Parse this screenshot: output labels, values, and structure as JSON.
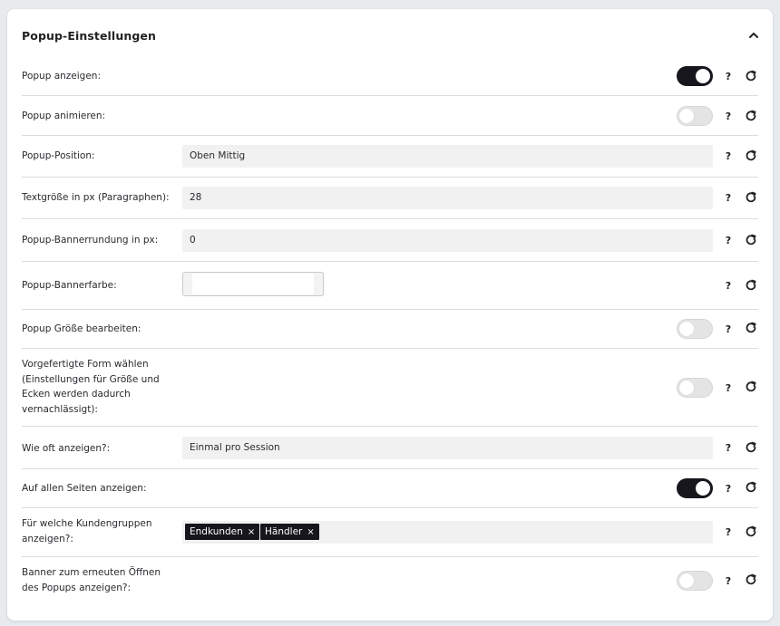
{
  "header": {
    "title": "Popup-Einstellungen",
    "collapse_icon": "chevron-up-icon"
  },
  "rows": [
    {
      "label": "Popup anzeigen:",
      "type": "toggle",
      "on": true
    },
    {
      "label": "Popup animieren:",
      "type": "toggle",
      "on": false
    },
    {
      "label": "Popup-Position:",
      "type": "select",
      "value": "Oben Mittig"
    },
    {
      "label": "Textgröße in px (Paragraphen):",
      "type": "input",
      "value": "28"
    },
    {
      "label": "Popup-Bannerrundung in px:",
      "type": "input",
      "value": "0"
    },
    {
      "label": "Popup-Bannerfarbe:",
      "type": "color",
      "value": "#ffffff"
    },
    {
      "label": "Popup Größe bearbeiten:",
      "type": "toggle",
      "on": false
    },
    {
      "label": "Vorgefertigte Form wählen (Einstellungen für Größe und Ecken werden dadurch vernachlässigt):",
      "type": "toggle",
      "on": false
    },
    {
      "label": "Wie oft anzeigen?:",
      "type": "select",
      "value": "Einmal pro Session"
    },
    {
      "label": "Auf allen Seiten anzeigen:",
      "type": "toggle",
      "on": true
    },
    {
      "label": "Für welche Kundengruppen anzeigen?:",
      "type": "tags",
      "tags": [
        "Endkunden",
        "Händler"
      ]
    },
    {
      "label": "Banner zum erneuten Öffnen des Popups anzeigen?:",
      "type": "toggle",
      "on": false
    }
  ],
  "help_label": "?",
  "tag_remove_label": "×",
  "icons": {
    "help": "question-mark-icon",
    "reset": "reset-icon",
    "remove": "close-icon"
  },
  "colors": {
    "toggle_on": "#16161c",
    "toggle_off": "#e4e4e4",
    "field_bg": "#f1f1f1"
  }
}
